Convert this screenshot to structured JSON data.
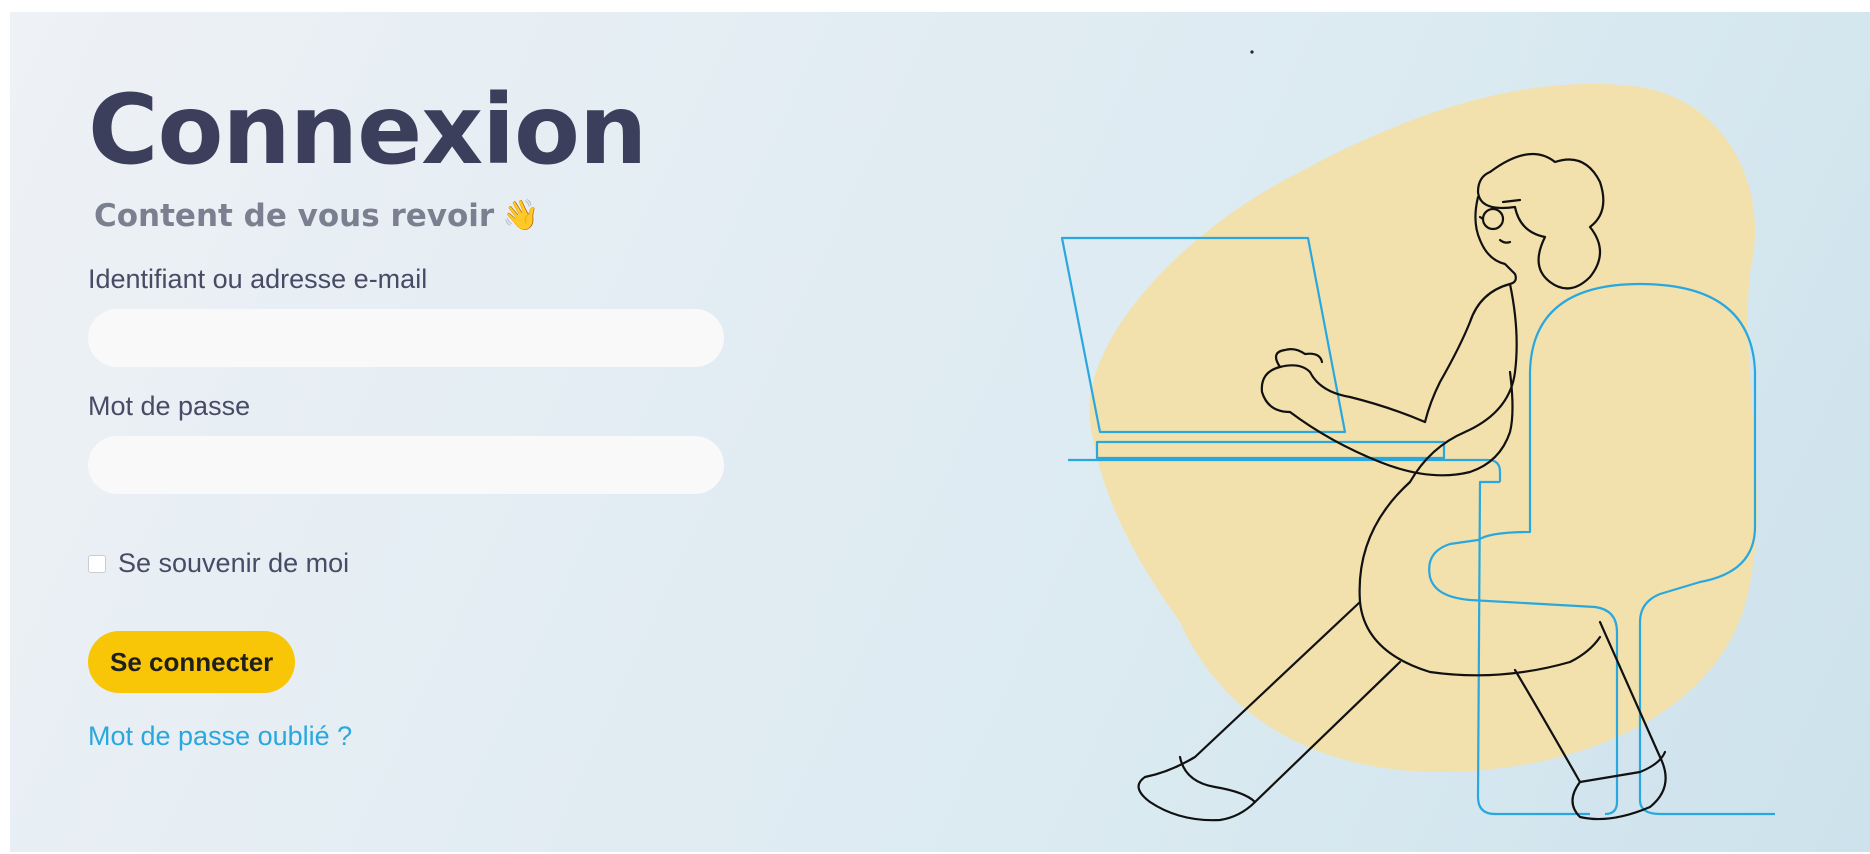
{
  "login": {
    "title": "Connexion",
    "subtitle": "Content de vous revoir",
    "subtitle_emoji": "👋",
    "username_label": "Identifiant ou adresse e-mail",
    "username_value": "",
    "password_label": "Mot de passe",
    "password_value": "",
    "remember_label": "Se souvenir de moi",
    "remember_checked": false,
    "submit_label": "Se connecter",
    "forgot_label": "Mot de passe oublié ?"
  },
  "illustration": {
    "subject": "woman-at-laptop",
    "blob_color": "#f2e1ac",
    "furniture_color": "#2aa7de",
    "figure_color": "#111111"
  },
  "colors": {
    "accent": "#f8c507",
    "link": "#2aa7de",
    "title": "#3b3f5c",
    "text": "#474b66"
  }
}
